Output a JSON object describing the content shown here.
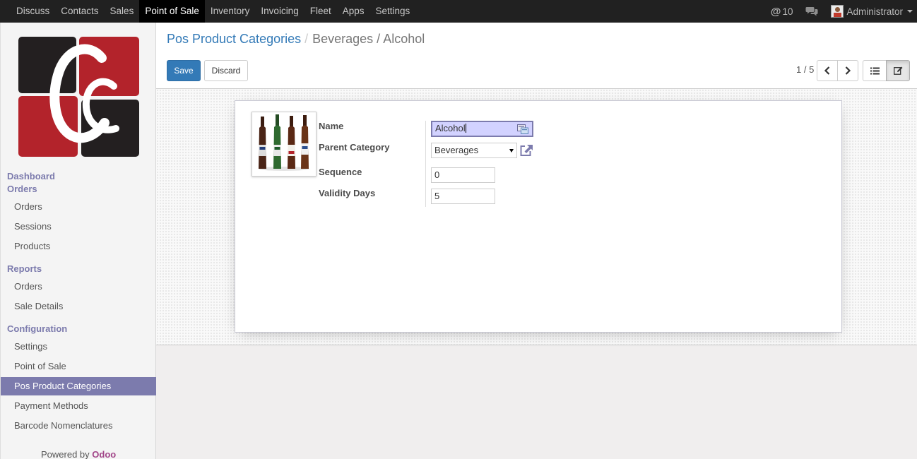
{
  "navbar": {
    "apps": [
      "Discuss",
      "Contacts",
      "Sales",
      "Point of Sale",
      "Inventory",
      "Invoicing",
      "Fleet",
      "Apps",
      "Settings"
    ],
    "active_app": "Point of Sale",
    "mentions_count": "10",
    "user": "Administrator"
  },
  "sidebar": {
    "heading_dashboard": "Dashboard",
    "heading_orders": "Orders",
    "orders_items": [
      "Orders",
      "Sessions",
      "Products"
    ],
    "heading_reports": "Reports",
    "reports_items": [
      "Orders",
      "Sale Details"
    ],
    "heading_configuration": "Configuration",
    "configuration_items": [
      "Settings",
      "Point of Sale",
      "Pos Product Categories",
      "Payment Methods",
      "Barcode Nomenclatures"
    ],
    "active_item": "Pos Product Categories",
    "powered_by": "Powered by",
    "powered_brand": "Odoo"
  },
  "control_panel": {
    "breadcrumb_parent": "Pos Product Categories",
    "breadcrumb_separator": "/",
    "breadcrumb_current": "Beverages / Alcohol",
    "save_label": "Save",
    "discard_label": "Discard",
    "pager": "1 / 5"
  },
  "form": {
    "name_label": "Name",
    "name_value": "Alcohol",
    "parent_label": "Parent Category",
    "parent_value": "Beverages",
    "sequence_label": "Sequence",
    "sequence_value": "0",
    "validity_label": "Validity Days",
    "validity_value": "5"
  },
  "colors": {
    "brand": "#7c7bad",
    "primary_button": "#337ab7",
    "topbar": "#212121",
    "logo_red": "#b3232b",
    "logo_dark": "#231f20"
  }
}
